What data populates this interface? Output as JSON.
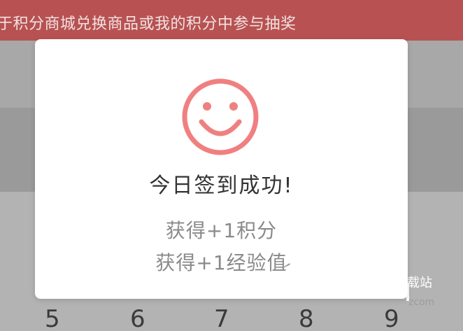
{
  "background": {
    "banner_text": "于积分商城兑换商品或我的积分中参与抽奖",
    "calendar_days": [
      "5",
      "6",
      "7",
      "8",
      "9"
    ],
    "watermark": "载站",
    "watermark_sub": "zcom"
  },
  "dialog": {
    "icon": "smile-icon",
    "title": "今日签到成功!",
    "rewards": [
      "获得+1积分",
      "获得+1经验值"
    ]
  },
  "colors": {
    "accent": "#f08080",
    "banner": "#b85252",
    "title": "#333333",
    "reward_text": "#8a8a8a"
  }
}
